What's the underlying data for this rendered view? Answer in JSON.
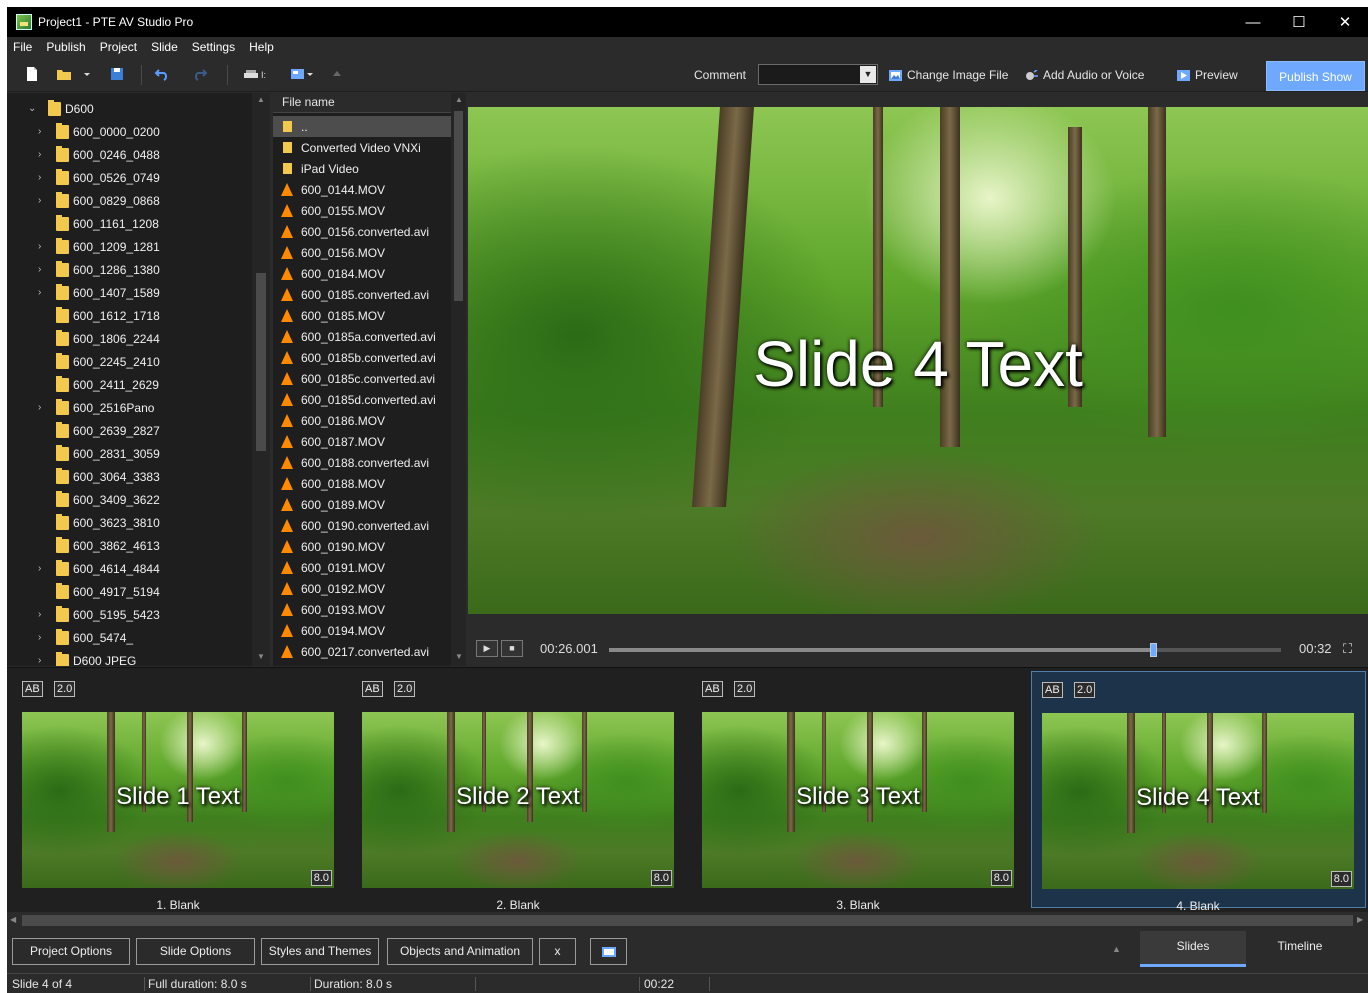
{
  "window": {
    "title": "Project1 - PTE AV Studio Pro",
    "controls": [
      "—",
      "☐",
      "✕"
    ]
  },
  "menu": [
    "File",
    "Publish",
    "Project",
    "Slide",
    "Settings",
    "Help"
  ],
  "toolbar": {
    "comment_label": "Comment",
    "comment_value": "",
    "change_image_file": "Change Image File",
    "add_audio": "Add Audio or Voice",
    "preview": "Preview",
    "publish_show": "Publish Show"
  },
  "folder_tree": {
    "root": "D600",
    "items": [
      {
        "label": "600_0000_0200",
        "expandable": true
      },
      {
        "label": "600_0246_0488",
        "expandable": true
      },
      {
        "label": "600_0526_0749",
        "expandable": true
      },
      {
        "label": "600_0829_0868",
        "expandable": true
      },
      {
        "label": "600_1161_1208",
        "expandable": false
      },
      {
        "label": "600_1209_1281",
        "expandable": true
      },
      {
        "label": "600_1286_1380",
        "expandable": true
      },
      {
        "label": "600_1407_1589",
        "expandable": true
      },
      {
        "label": "600_1612_1718",
        "expandable": false
      },
      {
        "label": "600_1806_2244",
        "expandable": false
      },
      {
        "label": "600_2245_2410",
        "expandable": false
      },
      {
        "label": "600_2411_2629",
        "expandable": false
      },
      {
        "label": "600_2516Pano",
        "expandable": true
      },
      {
        "label": "600_2639_2827",
        "expandable": false
      },
      {
        "label": "600_2831_3059",
        "expandable": false
      },
      {
        "label": "600_3064_3383",
        "expandable": false
      },
      {
        "label": "600_3409_3622",
        "expandable": false
      },
      {
        "label": "600_3623_3810",
        "expandable": false
      },
      {
        "label": "600_3862_4613",
        "expandable": false
      },
      {
        "label": "600_4614_4844",
        "expandable": true
      },
      {
        "label": "600_4917_5194",
        "expandable": false
      },
      {
        "label": "600_5195_5423",
        "expandable": true
      },
      {
        "label": "600_5474_",
        "expandable": true
      },
      {
        "label": "D600 JPEG",
        "expandable": true
      }
    ]
  },
  "file_list": {
    "header": "File name",
    "items": [
      {
        "label": "..",
        "type": "folder",
        "selected": true
      },
      {
        "label": "Converted Video VNXi",
        "type": "folder"
      },
      {
        "label": "iPad Video",
        "type": "folder"
      },
      {
        "label": "600_0144.MOV",
        "type": "video"
      },
      {
        "label": "600_0155.MOV",
        "type": "video"
      },
      {
        "label": "600_0156.converted.avi",
        "type": "video"
      },
      {
        "label": "600_0156.MOV",
        "type": "video"
      },
      {
        "label": "600_0184.MOV",
        "type": "video"
      },
      {
        "label": "600_0185.converted.avi",
        "type": "video"
      },
      {
        "label": "600_0185.MOV",
        "type": "video"
      },
      {
        "label": "600_0185a.converted.avi",
        "type": "video"
      },
      {
        "label": "600_0185b.converted.avi",
        "type": "video"
      },
      {
        "label": "600_0185c.converted.avi",
        "type": "video"
      },
      {
        "label": "600_0185d.converted.avi",
        "type": "video"
      },
      {
        "label": "600_0186.MOV",
        "type": "video"
      },
      {
        "label": "600_0187.MOV",
        "type": "video"
      },
      {
        "label": "600_0188.converted.avi",
        "type": "video"
      },
      {
        "label": "600_0188.MOV",
        "type": "video"
      },
      {
        "label": "600_0189.MOV",
        "type": "video"
      },
      {
        "label": "600_0190.converted.avi",
        "type": "video"
      },
      {
        "label": "600_0190.MOV",
        "type": "video"
      },
      {
        "label": "600_0191.MOV",
        "type": "video"
      },
      {
        "label": "600_0192.MOV",
        "type": "video"
      },
      {
        "label": "600_0193.MOV",
        "type": "video"
      },
      {
        "label": "600_0194.MOV",
        "type": "video"
      },
      {
        "label": "600_0217.converted.avi",
        "type": "video"
      }
    ]
  },
  "preview": {
    "text": "Slide 4 Text",
    "current_time": "00:26.001",
    "end_time": "00:32",
    "progress": 0.81
  },
  "slides": [
    {
      "badge_ab": "AB",
      "badge_speed": "2.0",
      "text": "Slide 1 Text",
      "duration": "8.0",
      "name": "1. Blank",
      "selected": false
    },
    {
      "badge_ab": "AB",
      "badge_speed": "2.0",
      "text": "Slide 2 Text",
      "duration": "8.0",
      "name": "2. Blank",
      "selected": false
    },
    {
      "badge_ab": "AB",
      "badge_speed": "2.0",
      "text": "Slide 3 Text",
      "duration": "8.0",
      "name": "3. Blank",
      "selected": false
    },
    {
      "badge_ab": "AB",
      "badge_speed": "2.0",
      "text": "Slide 4 Text",
      "duration": "8.0",
      "name": "4. Blank",
      "selected": true
    }
  ],
  "bottom_buttons": {
    "project_options": "Project Options",
    "slide_options": "Slide Options",
    "styles_themes": "Styles and Themes",
    "objects_animation": "Objects and Animation",
    "close": "x"
  },
  "tabs": {
    "slides": "Slides",
    "timeline": "Timeline"
  },
  "status": {
    "slide_count": "Slide 4 of 4",
    "full_duration": "Full duration: 8.0 s",
    "duration": "Duration: 8.0 s",
    "time": "00:22"
  },
  "colors": {
    "accent": "#6ea8ff",
    "folder": "#f2c94c",
    "video": "#ff8a00",
    "background": "#2b2b2b"
  }
}
